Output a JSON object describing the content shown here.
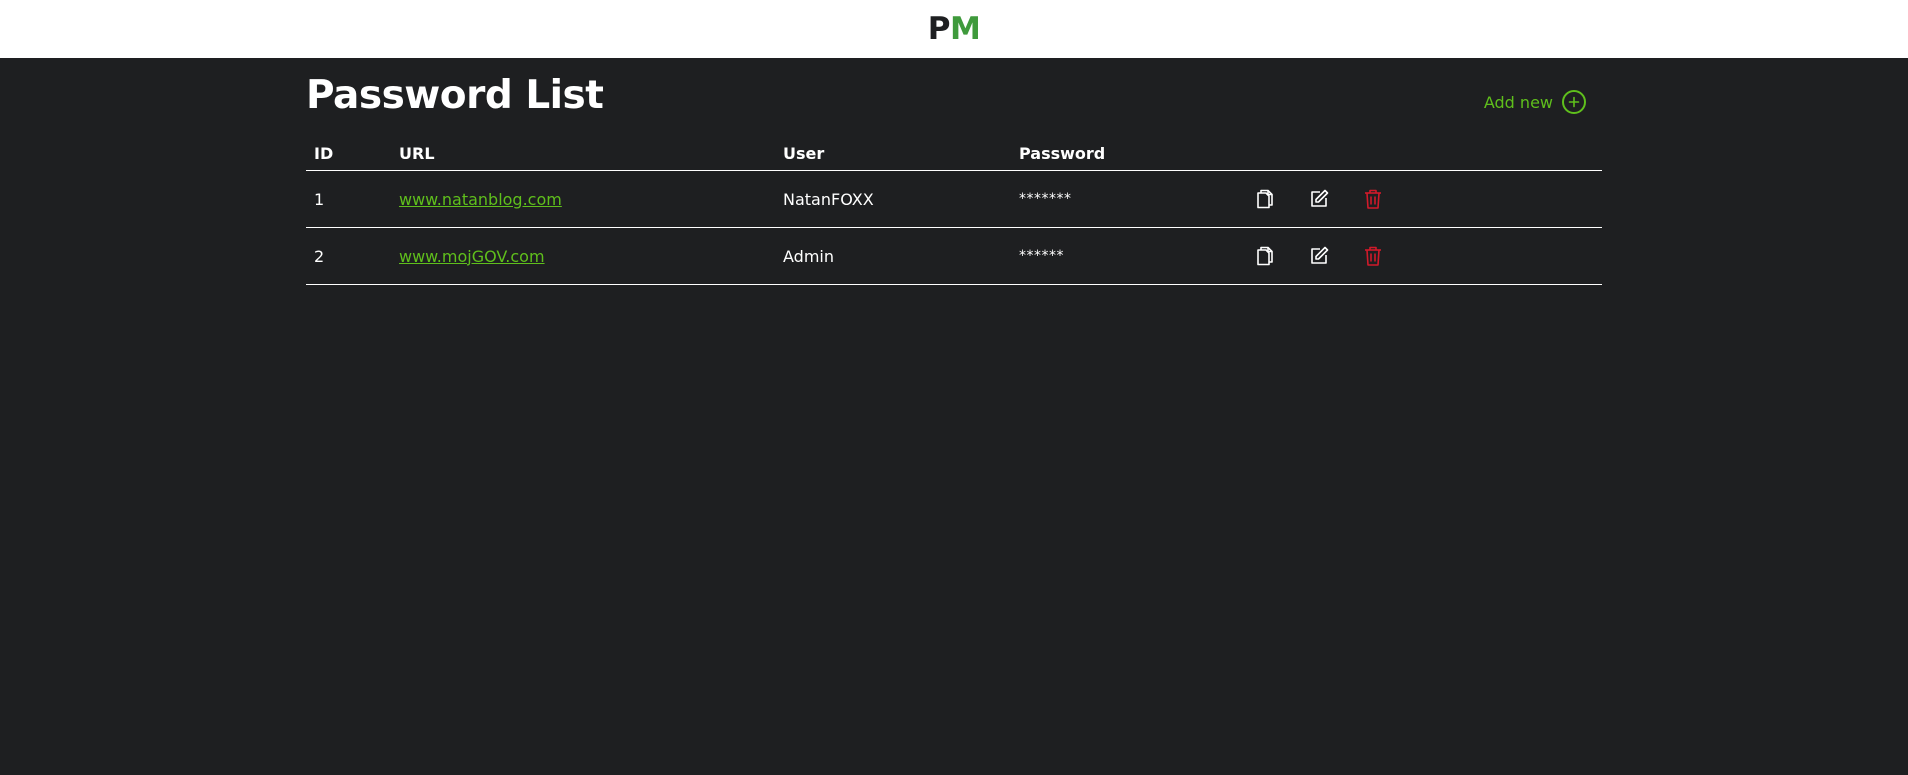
{
  "brand": {
    "logo_p": "P",
    "logo_m": "M",
    "accent": "#5fbf1c",
    "logo_green": "#3f9a3c",
    "danger": "#d11a2a",
    "background": "#1e1f21"
  },
  "page": {
    "title": "Password List"
  },
  "add_new": {
    "label": "Add new",
    "icon": "plus-circle-icon"
  },
  "table": {
    "headers": {
      "id": "ID",
      "url": "URL",
      "user": "User",
      "password": "Password"
    },
    "rows": [
      {
        "id": "1",
        "url": "www.natanblog.com",
        "user": "NatanFOXX",
        "password": "*******"
      },
      {
        "id": "2",
        "url": "www.mojGOV.com",
        "user": "Admin",
        "password": "******"
      }
    ],
    "row_actions": [
      "copy-icon",
      "edit-icon",
      "trash-icon"
    ]
  }
}
